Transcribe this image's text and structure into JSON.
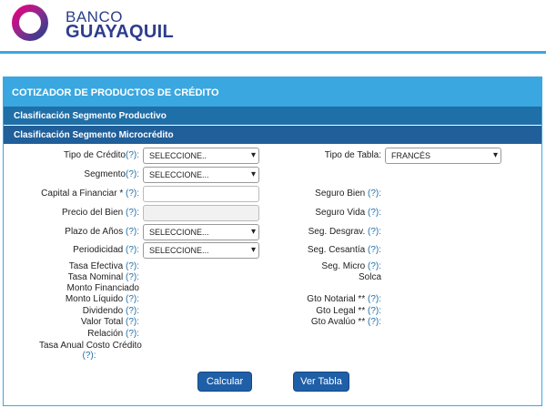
{
  "brand": {
    "line1": "BANCO",
    "line2": "GUAYAQUIL"
  },
  "panel": {
    "title": "COTIZADOR DE PRODUCTOS DE CRÉDITO",
    "section1": "Clasificación Segmento Productivo",
    "section2": "Clasificación Segmento Microcrédito"
  },
  "form": {
    "help": "(?):",
    "tipo_credito": {
      "label": "Tipo de Crédito",
      "value": "SELECCIONE.."
    },
    "segmento": {
      "label": "Segmento",
      "value": "SELECCIONE..."
    },
    "capital": {
      "label": "Capital a Financiar *"
    },
    "precio_bien": {
      "label": "Precio del Bien"
    },
    "plazo": {
      "label": "Plazo de Años",
      "value": "SELECCIONE..."
    },
    "periodicidad": {
      "label": "Periodicidad",
      "value": "SELECCIONE..."
    },
    "tasa_efectiva": "Tasa Efectiva",
    "tasa_nominal": "Tasa Nominal",
    "monto_financiado": "Monto Financiado",
    "monto_liquido": "Monto Líquido",
    "dividendo": "Dividendo",
    "valor_total": "Valor Total",
    "relacion": "Relación",
    "tasa_anual": "Tasa Anual Costo Crédito",
    "tipo_tabla": {
      "label": "Tipo de Tabla:",
      "value": "FRANCÉS"
    },
    "seguro_bien": "Seguro Bien",
    "seguro_vida": "Seguro Vida",
    "seg_desgrav": "Seg. Desgrav.",
    "seg_cesantia": "Seg. Cesantía",
    "seg_micro": "Seg. Micro",
    "solca": "Solca",
    "gto_notarial": "Gto Notarial **",
    "gto_legal": "Gto Legal **",
    "gto_avaluo": "Gto Avalúo **"
  },
  "buttons": {
    "calcular": "Calcular",
    "ver_tabla": "Ver Tabla"
  },
  "colors": {
    "brand": "#2c3e8c",
    "accent": "#3aa7e0",
    "section": "#1f6fa8",
    "button": "#1f5fa8"
  },
  "icons": {
    "dropdown": "chevron-down-icon",
    "logo": "bank-logo-icon"
  }
}
